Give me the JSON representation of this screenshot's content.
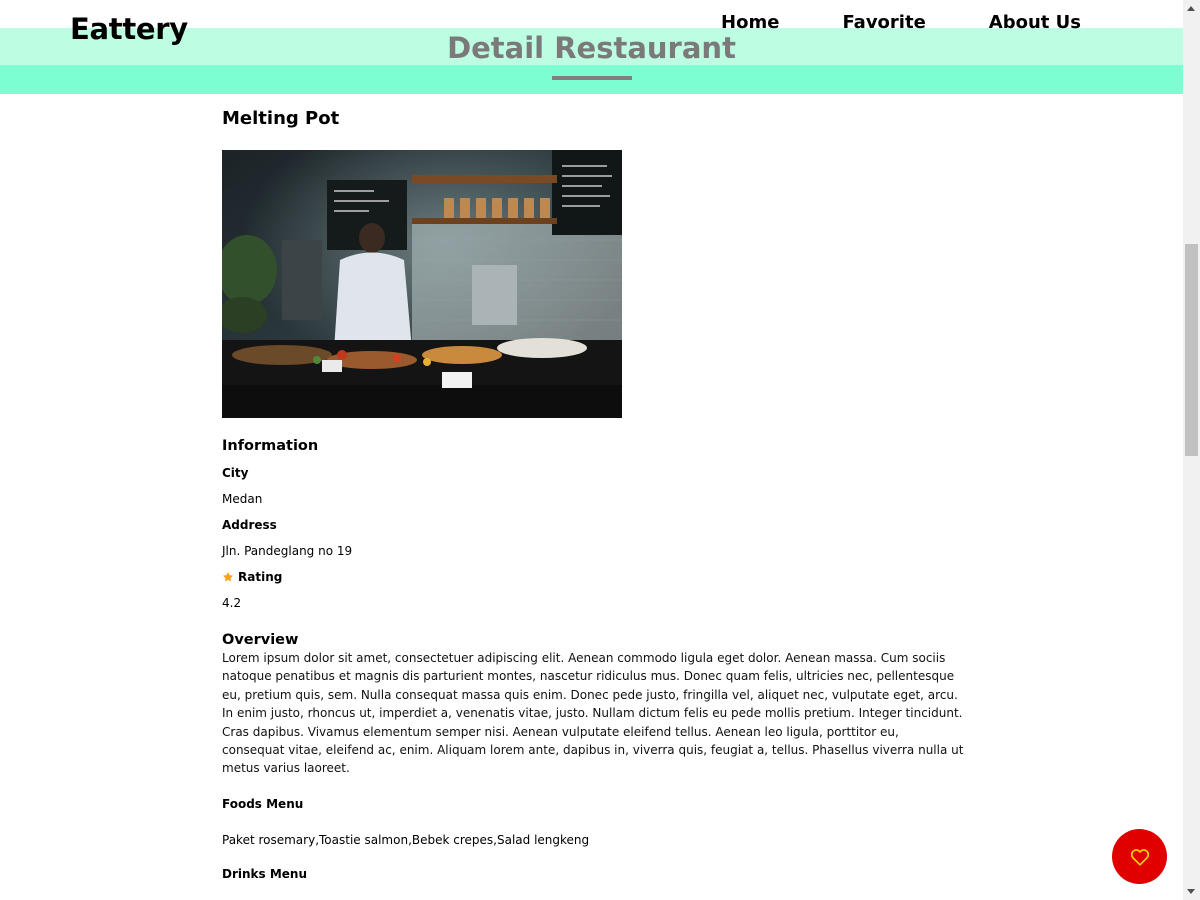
{
  "header": {
    "brand": "Eattery",
    "nav": [
      {
        "label": "Home"
      },
      {
        "label": "Favorite"
      },
      {
        "label": "About Us"
      }
    ],
    "page_title": "Detail Restaurant",
    "colors": {
      "band_light": "#bdfde1",
      "band_dark": "#7dfdd2",
      "title": "#7a7a7a"
    }
  },
  "restaurant": {
    "name": "Melting Pot",
    "image_icon": "restaurant-kitchen-photo",
    "information_title": "Information",
    "city_label": "City",
    "city": "Medan",
    "address_label": "Address",
    "address": "Jln. Pandeglang no 19",
    "rating_label": "Rating",
    "rating": "4.2",
    "rating_icon": "star-icon",
    "overview_title": "Overview",
    "overview": "Lorem ipsum dolor sit amet, consectetuer adipiscing elit. Aenean commodo ligula eget dolor. Aenean massa. Cum sociis natoque penatibus et magnis dis parturient montes, nascetur ridiculus mus. Donec quam felis, ultricies nec, pellentesque eu, pretium quis, sem. Nulla consequat massa quis enim. Donec pede justo, fringilla vel, aliquet nec, vulputate eget, arcu. In enim justo, rhoncus ut, imperdiet a, venenatis vitae, justo. Nullam dictum felis eu pede mollis pretium. Integer tincidunt. Cras dapibus. Vivamus elementum semper nisi. Aenean vulputate eleifend tellus. Aenean leo ligula, porttitor eu, consequat vitae, eleifend ac, enim. Aliquam lorem ante, dapibus in, viverra quis, feugiat a, tellus. Phasellus viverra nulla ut metus varius laoreet.",
    "foods_menu_label": "Foods Menu",
    "foods_menu": "Paket rosemary,Toastie salmon,Bebek crepes,Salad lengkeng",
    "drinks_menu_label": "Drinks Menu"
  },
  "favorite_button": {
    "icon": "heart-outline-icon",
    "color": "#e00000",
    "icon_color": "#ffd400"
  }
}
